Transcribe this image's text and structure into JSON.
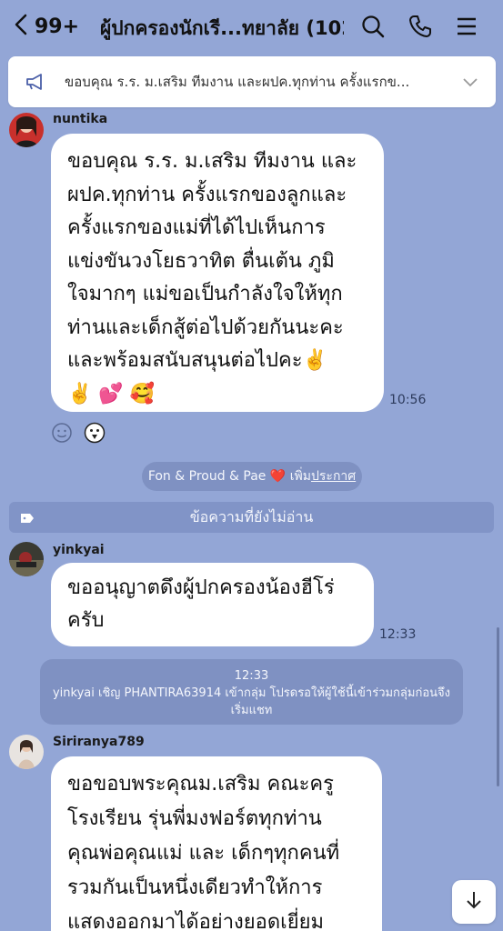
{
  "header": {
    "unread_count": "99+",
    "title": "ผู้ปกครองนักเรี...ทยาลัย (102)",
    "icons": [
      "chevron-left-icon",
      "search-icon",
      "phone-icon",
      "menu-icon"
    ]
  },
  "announcement": {
    "text": "ขอบคุณ ร.ร. ม.เสริม ทีมงาน และผปค.ทุกท่าน ครั้งแรกข...",
    "icon": "megaphone-icon"
  },
  "messages": [
    {
      "sender": "nuntika",
      "lines": [
        "ขอบคุณ ร.ร. ม.เสริม ทีมงาน และ",
        "ผปค.ทุกท่าน ครั้งแรกของลูกและ",
        "ครั้งแรกของแม่ที่ได้ไปเห็นการ",
        "แข่งขันวงโยธวาทิต ตื่นเต้น ภูมิ",
        "ใจมากๆ แม่ขอเป็นกำลังใจให้ทุก",
        "ท่านและเด็กสู้ต่อไปด้วยกันนะคะ",
        "และพร้อมสนับสนุนต่อไปคะ✌️",
        "✌️ 💕 🥰"
      ],
      "time": "10:56"
    },
    {
      "sender": "yinkyai",
      "lines": [
        "ขออนุญาตดึงผู้ปกครองน้องฮีโร่",
        "ครับ"
      ],
      "time": "12:33"
    },
    {
      "sender": "Siriranya789",
      "lines": [
        "ขอขอบพระคุณม.เสริม คณะครู",
        "โรงเรียน รุ่นพี่มงฟอร์ตทุกท่าน",
        "คุณพ่อคุณแม่ และ เด็กๆทุกคนที่",
        "รวมกันเป็นหนึ่งเดียวทำให้การ",
        "แสดงออกมาได้อย่างยอดเยี่ยม"
      ]
    }
  ],
  "announce_pill": {
    "prefix": "Fon & Proud & Pae",
    "heart": "❤️",
    "suffix_plain": "เพิ่ม",
    "suffix_link": "ประกาศ"
  },
  "unread_bar": {
    "label": "ข้อความที่ยังไม่อ่าน"
  },
  "system_message": {
    "time": "12:33",
    "line1": "yinkyai เชิญ PHANTIRA63914 เข้ากลุ่ม โปรดรอให้ผู้ใช้นี้เข้าร่วมกลุ่มก่อนจึง",
    "line2": "เริ่มแชท"
  },
  "colors": {
    "background": "#93a6d6",
    "bubble": "#ffffff",
    "pill": "#7f91c2"
  }
}
